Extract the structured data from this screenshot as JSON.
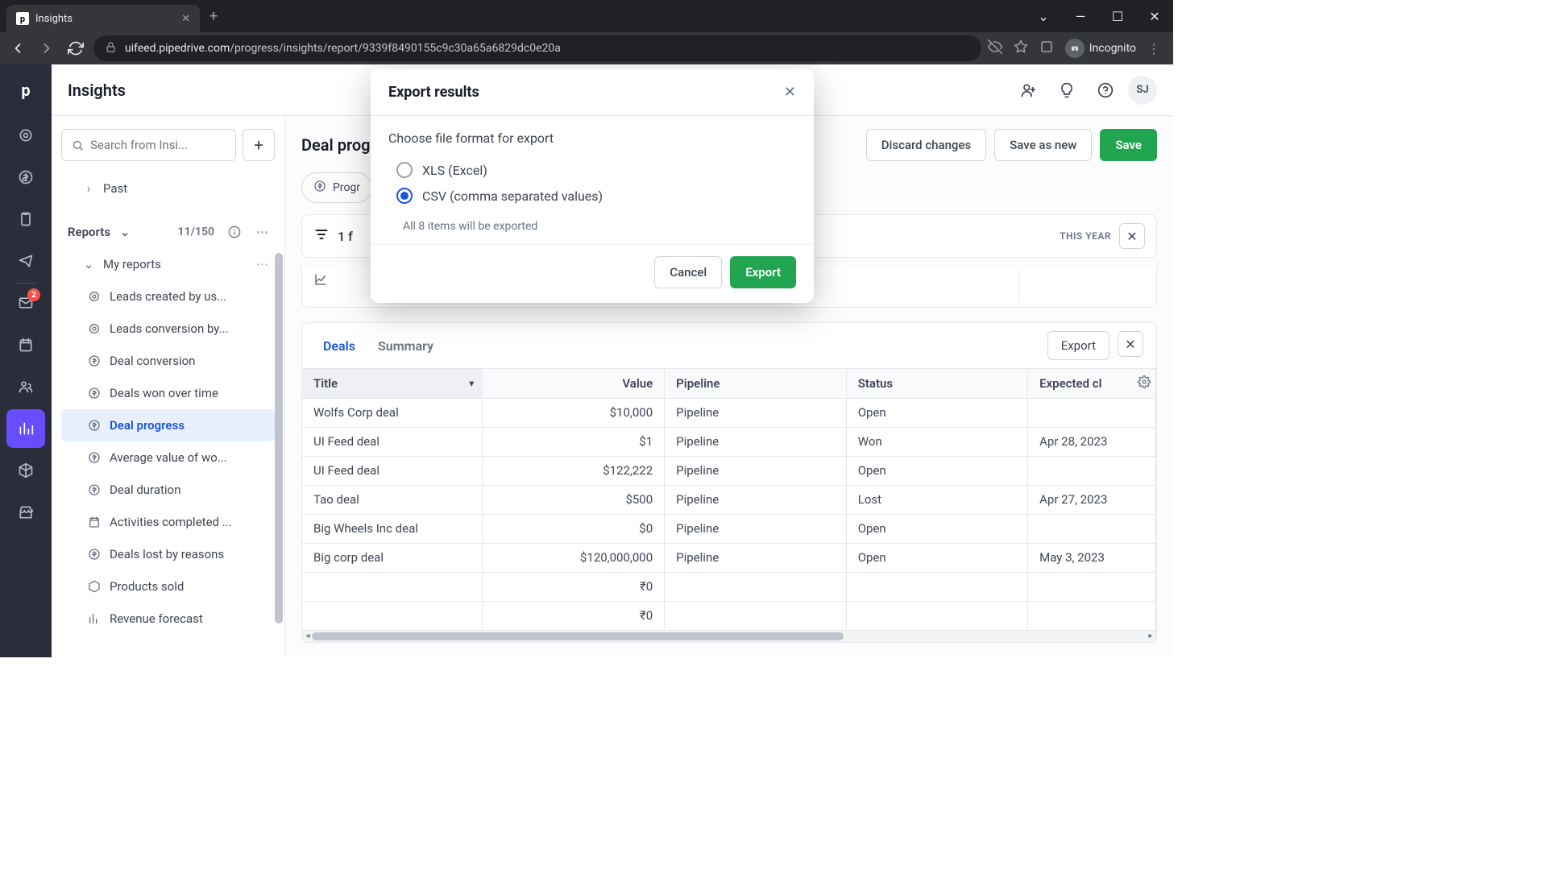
{
  "browser": {
    "tab_title": "Insights",
    "url_domain": "uifeed.pipedrive.com",
    "url_path": "/progress/insights/report/9339f8490155c9c30a65a6829dc0e20a",
    "incognito_label": "Incognito"
  },
  "header": {
    "title": "Insights",
    "avatar": "SJ"
  },
  "sidebar": {
    "search_placeholder": "Search from Insi...",
    "past_label": "Past",
    "reports_label": "Reports",
    "reports_count": "11/150",
    "my_reports_label": "My reports",
    "items": [
      "Leads created by us...",
      "Leads conversion by...",
      "Deal conversion",
      "Deals won over time",
      "Deal progress",
      "Average value of wo...",
      "Deal duration",
      "Activities completed ...",
      "Deals lost by reasons",
      "Products sold",
      "Revenue forecast"
    ],
    "active_index": 4
  },
  "rail": {
    "mail_badge": "2"
  },
  "main": {
    "title": "Deal prog",
    "discard": "Discard changes",
    "save_as_new": "Save as new",
    "save": "Save",
    "chip": "Progr",
    "filter_count": "1 f",
    "period": "THIS YEAR"
  },
  "table": {
    "tabs": {
      "deals": "Deals",
      "summary": "Summary"
    },
    "export_btn": "Export",
    "columns": [
      "Title",
      "Value",
      "Pipeline",
      "Status",
      "Expected cl"
    ],
    "rows": [
      {
        "title": "Wolfs Corp deal",
        "value": "$10,000",
        "pipeline": "Pipeline",
        "status": "Open",
        "expected": ""
      },
      {
        "title": "UI Feed deal",
        "value": "$1",
        "pipeline": "Pipeline",
        "status": "Won",
        "expected": "Apr 28, 2023"
      },
      {
        "title": "UI Feed deal",
        "value": "$122,222",
        "pipeline": "Pipeline",
        "status": "Open",
        "expected": ""
      },
      {
        "title": "Tao deal",
        "value": "$500",
        "pipeline": "Pipeline",
        "status": "Lost",
        "expected": "Apr 27, 2023"
      },
      {
        "title": "Big Wheels Inc deal",
        "value": "$0",
        "pipeline": "Pipeline",
        "status": "Open",
        "expected": ""
      },
      {
        "title": "Big corp deal",
        "value": "$120,000,000",
        "pipeline": "Pipeline",
        "status": "Open",
        "expected": "May 3, 2023"
      },
      {
        "title": "",
        "value": "₹0",
        "pipeline": "",
        "status": "",
        "expected": ""
      },
      {
        "title": "",
        "value": "₹0",
        "pipeline": "",
        "status": "",
        "expected": ""
      }
    ]
  },
  "modal": {
    "title": "Export results",
    "prompt": "Choose file format for export",
    "option_xls": "XLS (Excel)",
    "option_csv": "CSV (comma separated values)",
    "note": "All 8 items will be exported",
    "cancel": "Cancel",
    "export": "Export"
  }
}
